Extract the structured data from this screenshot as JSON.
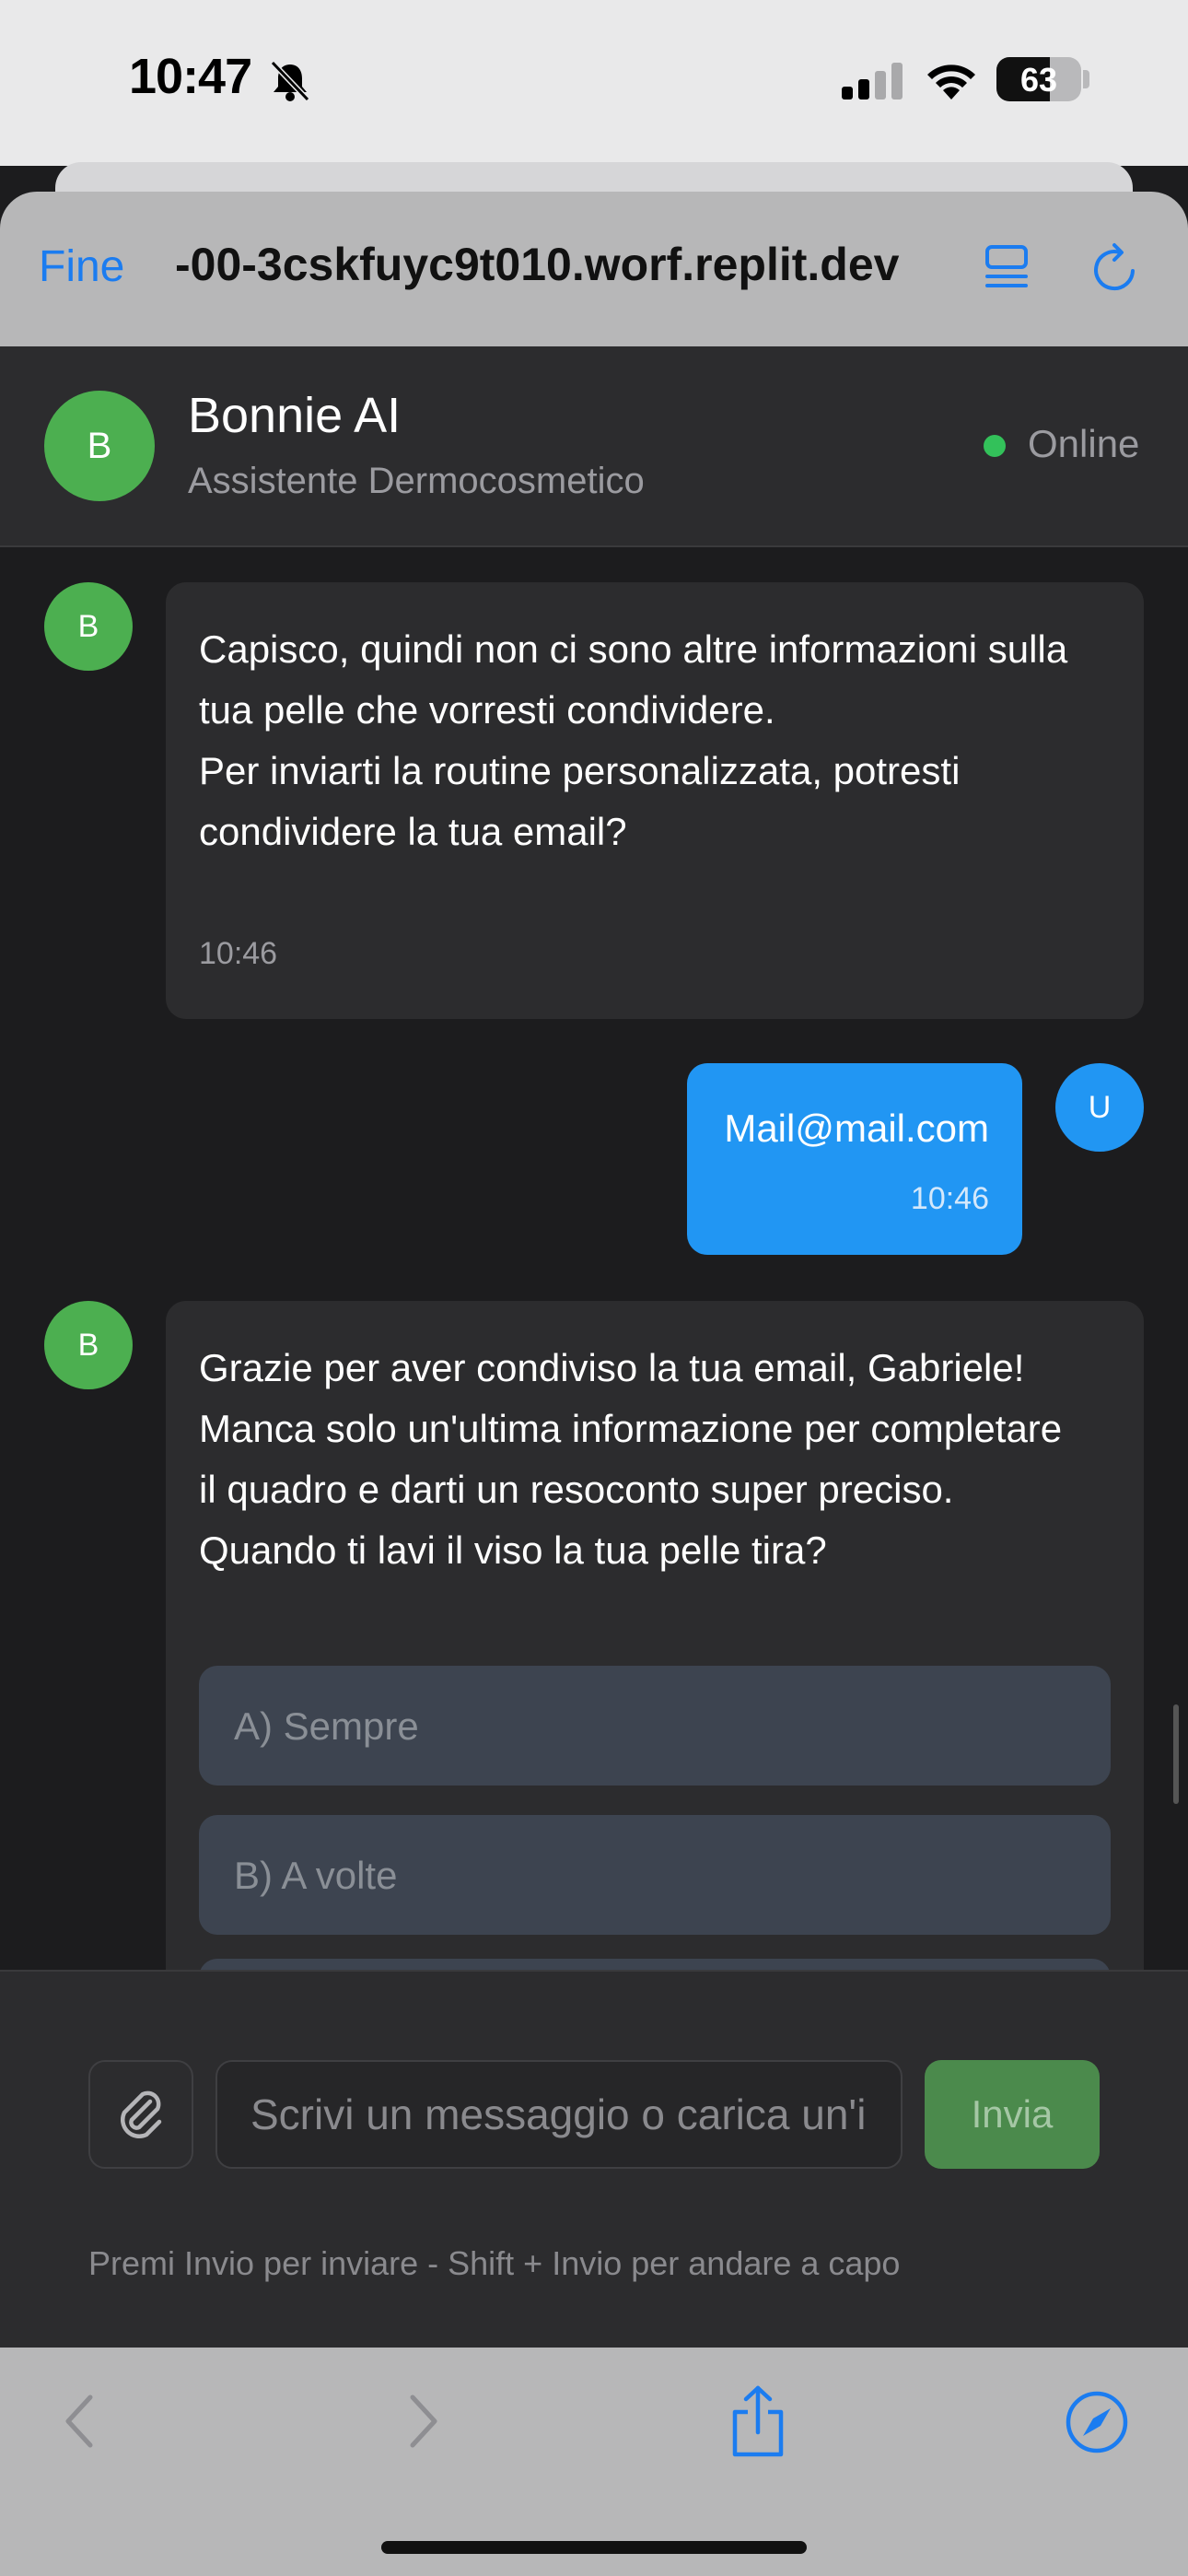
{
  "status_bar": {
    "time": "10:47",
    "battery": "63",
    "battery_level": 0.63
  },
  "browser": {
    "done_label": "Fine",
    "url": "-00-3cskfuyc9t010.worf.replit.dev"
  },
  "header": {
    "avatar_letter": "B",
    "title": "Bonnie AI",
    "subtitle": "Assistente Dermocosmetico",
    "status": "Online"
  },
  "messages": [
    {
      "sender": "bot",
      "avatar": "B",
      "paragraphs": [
        [
          "Capisco, quindi non ci sono altre informazioni sulla",
          "tua pelle che vorresti condividere."
        ],
        [
          "Per inviarti la routine personalizzata, potresti",
          "condividere la tua email?"
        ]
      ],
      "time": "10:46"
    },
    {
      "sender": "user",
      "avatar": "U",
      "text": "Mail@mail.com",
      "time": "10:46"
    },
    {
      "sender": "bot",
      "avatar": "B",
      "paragraphs": [
        [
          "Grazie per aver condiviso la tua email, Gabriele!",
          "Manca solo un'ultima informazione per completare",
          "il quadro e darti un resoconto super preciso."
        ],
        [
          "Quando ti lavi il viso la tua pelle tira?"
        ]
      ],
      "options": [
        "A) Sempre",
        "B) A volte"
      ]
    }
  ],
  "composer": {
    "placeholder": "Scrivi un messaggio o carica un'immagine...",
    "send_label": "Invia",
    "hint": "Premi Invio per inviare - Shift + Invio per andare a capo"
  },
  "icons": {
    "bell": "bell-slash-icon",
    "signal": "cellular-signal-icon",
    "wifi": "wifi-icon",
    "reader": "reader-mode-icon",
    "reload": "reload-icon",
    "attach": "paperclip-icon",
    "back": "chevron-left-icon",
    "forward": "chevron-right-icon",
    "share": "share-icon",
    "compass": "compass-icon"
  },
  "colors": {
    "accent_blue": "#1b7cf0",
    "bot_green": "#4caf50",
    "user_blue": "#2196f3",
    "online_green": "#33c15a"
  }
}
